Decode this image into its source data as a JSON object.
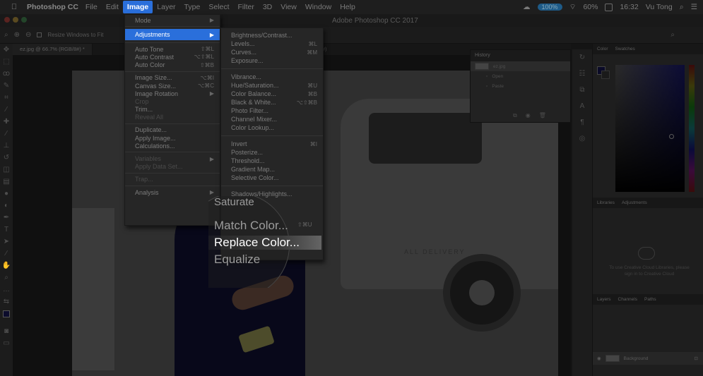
{
  "menubar": {
    "app_name": "Photoshop CC",
    "items": [
      "File",
      "Edit",
      "Image",
      "Layer",
      "Type",
      "Select",
      "Filter",
      "3D",
      "View",
      "Window",
      "Help"
    ],
    "status_pill": "100%",
    "battery": "60%",
    "time": "16:32",
    "user": "Vu Tong"
  },
  "ps_title": "Adobe Photoshop CC 2017",
  "options_bar": {
    "resize_label": "Resize Windows to Fit"
  },
  "tabs": [
    {
      "label": "ez.jpg @ 66.7% (RGB/8#) *"
    },
    {
      "label": "(RGB/8#)"
    }
  ],
  "image_menu": [
    {
      "label": "Mode",
      "shortcut": "▶"
    },
    {
      "sep": true
    },
    {
      "label": "Adjustments",
      "shortcut": "▶",
      "highlight": true
    },
    {
      "sep": true
    },
    {
      "label": "Auto Tone",
      "shortcut": "⇧⌘L"
    },
    {
      "label": "Auto Contrast",
      "shortcut": "⌥⇧⌘L"
    },
    {
      "label": "Auto Color",
      "shortcut": "⇧⌘B"
    },
    {
      "sep": true
    },
    {
      "label": "Image Size...",
      "shortcut": "⌥⌘I"
    },
    {
      "label": "Canvas Size...",
      "shortcut": "⌥⌘C"
    },
    {
      "label": "Image Rotation",
      "shortcut": "▶"
    },
    {
      "label": "Crop",
      "shortcut": "",
      "dim": true
    },
    {
      "label": "Trim...",
      "shortcut": ""
    },
    {
      "label": "Reveal All",
      "shortcut": "",
      "dim": true
    },
    {
      "sep": true
    },
    {
      "label": "Duplicate...",
      "shortcut": ""
    },
    {
      "label": "Apply Image...",
      "shortcut": ""
    },
    {
      "label": "Calculations...",
      "shortcut": ""
    },
    {
      "sep": true
    },
    {
      "label": "Variables",
      "shortcut": "▶",
      "dim": true
    },
    {
      "label": "Apply Data Set...",
      "shortcut": "",
      "dim": true
    },
    {
      "sep": true
    },
    {
      "label": "Trap...",
      "shortcut": "",
      "dim": true
    },
    {
      "sep": true
    },
    {
      "label": "Analysis",
      "shortcut": "▶"
    }
  ],
  "adjustments_menu": [
    {
      "label": "Brightness/Contrast...",
      "shortcut": ""
    },
    {
      "label": "Levels...",
      "shortcut": "⌘L"
    },
    {
      "label": "Curves...",
      "shortcut": "⌘M"
    },
    {
      "label": "Exposure...",
      "shortcut": ""
    },
    {
      "sep": true
    },
    {
      "label": "Vibrance...",
      "shortcut": ""
    },
    {
      "label": "Hue/Saturation...",
      "shortcut": "⌘U"
    },
    {
      "label": "Color Balance...",
      "shortcut": "⌘B"
    },
    {
      "label": "Black & White...",
      "shortcut": "⌥⇧⌘B"
    },
    {
      "label": "Photo Filter...",
      "shortcut": ""
    },
    {
      "label": "Channel Mixer...",
      "shortcut": ""
    },
    {
      "label": "Color Lookup...",
      "shortcut": ""
    },
    {
      "sep": true
    },
    {
      "label": "Invert",
      "shortcut": "⌘I"
    },
    {
      "label": "Posterize...",
      "shortcut": ""
    },
    {
      "label": "Threshold...",
      "shortcut": ""
    },
    {
      "label": "Gradient Map...",
      "shortcut": ""
    },
    {
      "label": "Selective Color...",
      "shortcut": ""
    },
    {
      "sep": true
    },
    {
      "label": "Shadows/Highlights...",
      "shortcut": ""
    }
  ],
  "magnifier": {
    "items": [
      "Saturate",
      "Match Color...",
      "Replace Color...",
      "Equalize"
    ],
    "shortcut": "⇧⌘U"
  },
  "history": {
    "title": "History",
    "rows": [
      "ez.jpg",
      "Open",
      "Paste"
    ]
  },
  "right": {
    "color_tabs": [
      "Color",
      "Swatches"
    ],
    "lib_tabs": [
      "Libraries",
      "Adjustments"
    ],
    "lib_message": "To use Creative Cloud Libraries, please sign in to Creative Cloud",
    "layer_tabs": [
      "Layers",
      "Channels",
      "Paths"
    ],
    "layer_name": "Background"
  },
  "photo": {
    "van_text": "ALL DELIVERY"
  }
}
